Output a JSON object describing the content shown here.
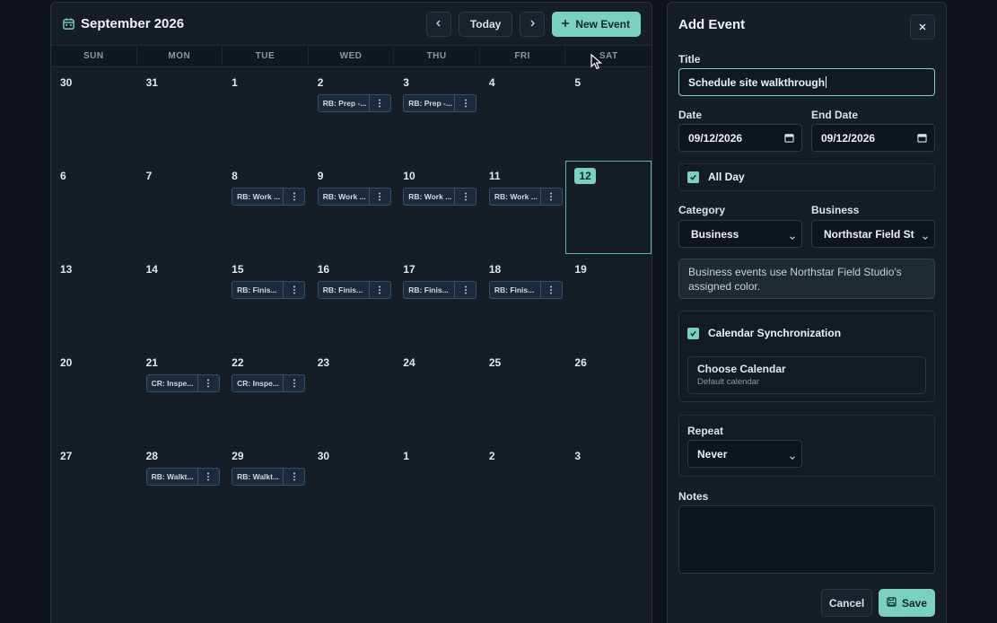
{
  "calendar": {
    "title": "September 2026",
    "today_label": "Today",
    "new_event_label": "New Event",
    "weekdays": [
      "SUN",
      "MON",
      "TUE",
      "WED",
      "THU",
      "FRI",
      "SAT"
    ],
    "weeks": [
      [
        {
          "day": "30"
        },
        {
          "day": "31"
        },
        {
          "day": "1"
        },
        {
          "day": "2",
          "event": "RB: Prep -..."
        },
        {
          "day": "3",
          "event": "RB: Prep -..."
        },
        {
          "day": "4"
        },
        {
          "day": "5"
        }
      ],
      [
        {
          "day": "6"
        },
        {
          "day": "7"
        },
        {
          "day": "8",
          "event": "RB: Work ..."
        },
        {
          "day": "9",
          "event": "RB: Work ..."
        },
        {
          "day": "10",
          "event": "RB: Work ..."
        },
        {
          "day": "11",
          "event": "RB: Work ..."
        },
        {
          "day": "12",
          "today": true
        }
      ],
      [
        {
          "day": "13"
        },
        {
          "day": "14"
        },
        {
          "day": "15",
          "event": "RB: Finis..."
        },
        {
          "day": "16",
          "event": "RB: Finis..."
        },
        {
          "day": "17",
          "event": "RB: Finis..."
        },
        {
          "day": "18",
          "event": "RB: Finis..."
        },
        {
          "day": "19"
        }
      ],
      [
        {
          "day": "20"
        },
        {
          "day": "21",
          "event": "CR: Inspe..."
        },
        {
          "day": "22",
          "event": "CR: Inspe..."
        },
        {
          "day": "23"
        },
        {
          "day": "24"
        },
        {
          "day": "25"
        },
        {
          "day": "26"
        }
      ],
      [
        {
          "day": "27"
        },
        {
          "day": "28",
          "event": "RB: Walkt..."
        },
        {
          "day": "29",
          "event": "RB: Walkt..."
        },
        {
          "day": "30"
        },
        {
          "day": "1"
        },
        {
          "day": "2"
        },
        {
          "day": "3"
        }
      ]
    ]
  },
  "form": {
    "heading": "Add Event",
    "title_label": "Title",
    "title_value": "Schedule site walkthrough",
    "date_label": "Date",
    "date_value": "09/12/2026",
    "end_date_label": "End Date",
    "end_date_value": "09/12/2026",
    "all_day_label": "All Day",
    "category_label": "Category",
    "category_value": "Business",
    "business_label": "Business",
    "business_value": "Northstar Field Studio",
    "info_text": "Business events use Northstar Field Studio's assigned color.",
    "sync_label": "Calendar Synchronization",
    "choose_calendar_title": "Choose Calendar",
    "choose_calendar_sub": "Default calendar",
    "repeat_label": "Repeat",
    "repeat_value": "Never",
    "notes_label": "Notes",
    "cancel_label": "Cancel",
    "save_label": "Save"
  },
  "colors": {
    "accent": "#7bd1bf",
    "event_chip": "#1d2a3d"
  }
}
